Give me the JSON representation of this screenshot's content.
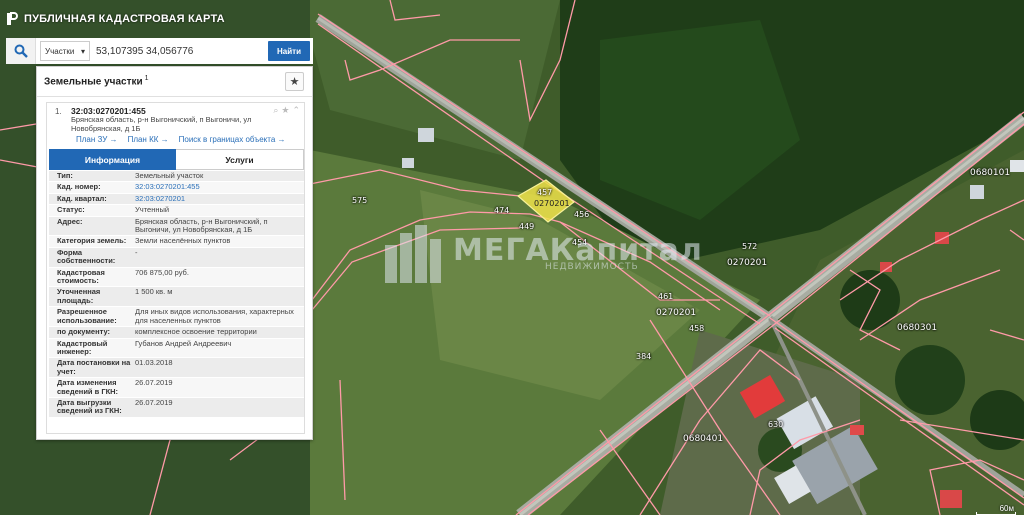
{
  "header": {
    "title": "ПУБЛИЧНАЯ КАДАСТРОВАЯ КАРТА"
  },
  "search": {
    "type_label": "Участки",
    "query": "53,107395 34,056776",
    "submit_label": "Найти"
  },
  "panel": {
    "title": "Земельные участки",
    "count": "1",
    "card": {
      "index": "1.",
      "cad_number": "32:03:0270201:455",
      "address": "Брянская область, р-н Выгоничский, п Выгоничи, ул Новобрянская, д 1Б",
      "links": [
        "План ЗУ →",
        "План КК →",
        "Поиск в границах объекта →"
      ],
      "tabs": [
        "Информация",
        "Услуги"
      ],
      "props": [
        {
          "k": "Тип:",
          "v": "Земельный участок"
        },
        {
          "k": "Кад. номер:",
          "v": "32:03:0270201:455",
          "link": true
        },
        {
          "k": "Кад. квартал:",
          "v": "32:03:0270201",
          "link": true
        },
        {
          "k": "Статус:",
          "v": "Учтенный"
        },
        {
          "k": "Адрес:",
          "v": "Брянская область, р-н Выгоничский, п Выгоничи, ул Новобрянская, д 1Б"
        },
        {
          "k": "Категория земель:",
          "v": "Земли населённых пунктов"
        },
        {
          "k": "Форма собственности:",
          "v": "-"
        },
        {
          "k": "Кадастровая стоимость:",
          "v": "706 875,00 руб."
        },
        {
          "k": "Уточненная площадь:",
          "v": "1 500 кв. м"
        },
        {
          "k": "Разрешенное использование:",
          "v": "Для иных видов использования, характерных для населенных пунктов"
        },
        {
          "k": "по документу:",
          "v": "комплексное освоение территории"
        },
        {
          "k": "Кадастровый инженер:",
          "v": "Губанов Андрей Андреевич"
        },
        {
          "k": "Дата постановки на учет:",
          "v": "01.03.2018"
        },
        {
          "k": "Дата изменения сведений в ГКН:",
          "v": "26.07.2019"
        },
        {
          "k": "Дата выгрузки сведений из ГКН:",
          "v": "26.07.2019"
        }
      ]
    }
  },
  "map": {
    "labels": [
      "457",
      "474",
      "449",
      "456",
      "454",
      "575",
      "572",
      "461",
      "458",
      "384",
      "0270201",
      "0680101",
      "0680301",
      "0680401",
      "630",
      "0270201"
    ],
    "selected_parcel_label": "0270201"
  },
  "watermark": {
    "brand": "МЕГАКапитал",
    "sub": "НЕДВИЖИМОСТЬ"
  },
  "scale": {
    "label": "60м"
  },
  "colors": {
    "accent": "#2168b5",
    "parcel_border": "#ff9aa8",
    "selected_fill": "#f0e34a"
  }
}
